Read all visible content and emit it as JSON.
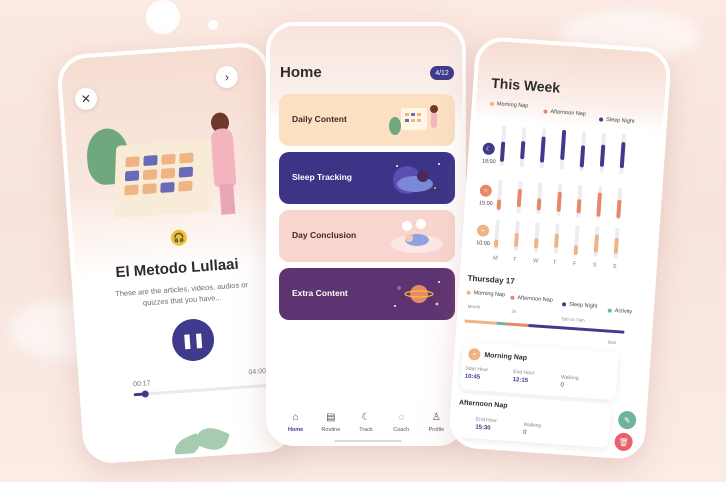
{
  "colors": {
    "primary": "#3f3a8c",
    "morning": "#f0b484",
    "afternoon": "#e9876a",
    "night": "#3f3a8c",
    "activity": "#6fb39a",
    "daily": "#fbe0c2",
    "sleep": "#3d3488",
    "conclusion": "#f8d6cf",
    "extra": "#5d3372"
  },
  "player": {
    "close_icon": "close-icon",
    "next_icon": "chevron-right-icon",
    "headphone_icon": "headphones-icon",
    "title": "El Metodo Lullaai",
    "description": "These are the articles, videos, audios or quizzes that you have...",
    "elapsed": "00:17",
    "duration": "04:00",
    "progress": 0.08
  },
  "home": {
    "title": "Home",
    "badge": "4/12",
    "cards": [
      {
        "label": "Daily Content"
      },
      {
        "label": "Sleep Tracking"
      },
      {
        "label": "Day Conclusion"
      },
      {
        "label": "Extra Content"
      }
    ],
    "nav": [
      {
        "label": "Home",
        "icon": "home-icon"
      },
      {
        "label": "Routine",
        "icon": "routine-icon"
      },
      {
        "label": "Track",
        "icon": "moon-icon"
      },
      {
        "label": "Coach",
        "icon": "chat-icon"
      },
      {
        "label": "Profile",
        "icon": "profile-icon"
      }
    ]
  },
  "week": {
    "title": "This Week",
    "legend": [
      "Morning Nap",
      "Afternoon Nap",
      "Sleep Night"
    ],
    "rows": [
      {
        "time": "18:00",
        "icon": "moon-icon"
      },
      {
        "time": "15:00",
        "icon": "sun-icon"
      },
      {
        "time": "10:00",
        "icon": "sunrise-icon"
      }
    ],
    "days": [
      "M",
      "T",
      "W",
      "T",
      "F",
      "S",
      "S"
    ]
  },
  "day": {
    "title": "Thursday 17",
    "legend": [
      "Morning Nap",
      "Afternoon Nap",
      "Sleep Night",
      "Activity"
    ],
    "ruler": [
      "Month",
      "2h",
      "7pm to 7am",
      "8am"
    ],
    "timeline": [
      {
        "kind": "morning",
        "share": 0.2
      },
      {
        "kind": "activity",
        "share": 0.06
      },
      {
        "kind": "afternoon",
        "share": 0.14
      },
      {
        "kind": "night",
        "share": 0.6
      }
    ],
    "cards": [
      {
        "title": "Morning Nap",
        "start_label": "Start Hour",
        "start": "10:45",
        "end_label": "End Hour",
        "end": "12:15",
        "walking_label": "Walking",
        "walking": "0"
      },
      {
        "title": "Afternoon Nap",
        "start_label": "Start Hour",
        "start": "",
        "end_label": "End Hour",
        "end": "15:30",
        "walking_label": "Walking",
        "walking": "0"
      }
    ]
  }
}
